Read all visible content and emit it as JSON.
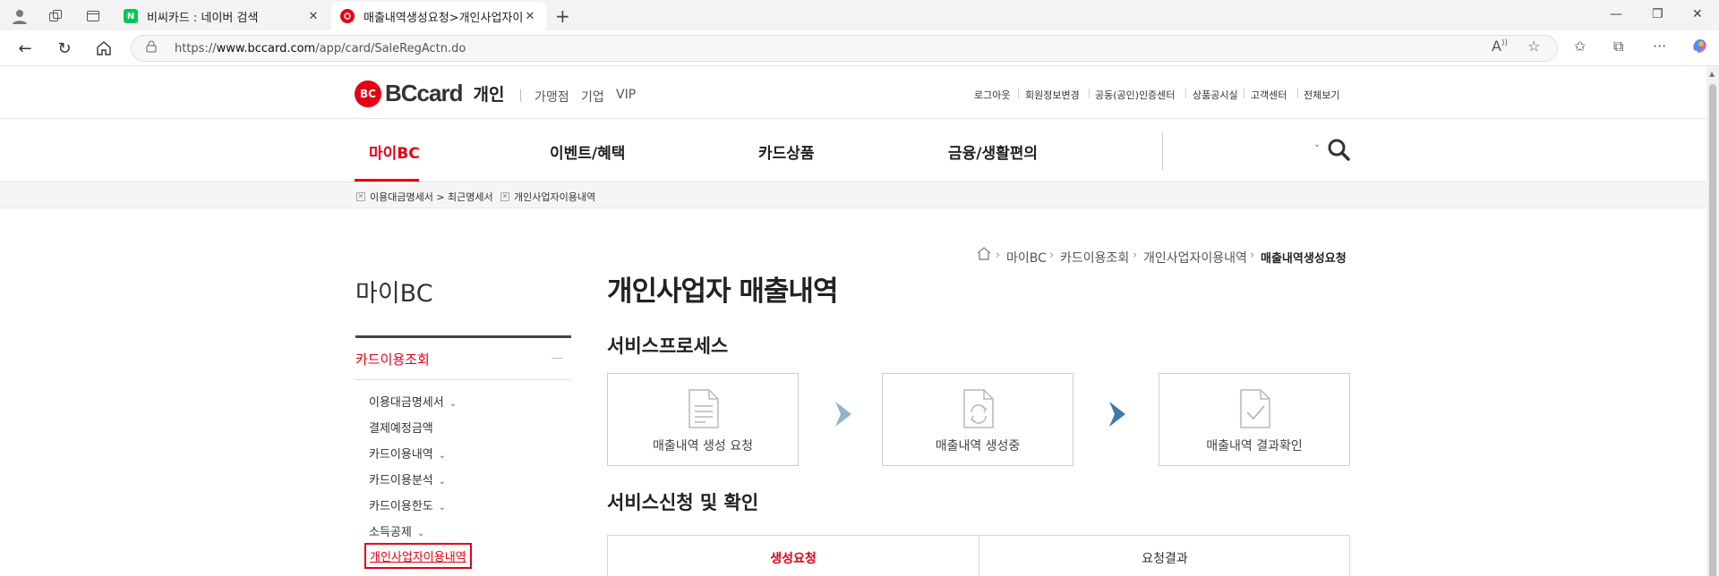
{
  "browser": {
    "tabs": [
      {
        "title": "비씨카드 : 네이버 검색",
        "favicon": "naver-icon",
        "favicon_text": "N",
        "favicon_color": "#03c75a"
      },
      {
        "title": "매출내역생성요청>개인사업자이용내역",
        "favicon": "bccard-icon",
        "favicon_color": "#e60012"
      }
    ],
    "url": {
      "prefix": "https://",
      "host": "www.bccard.com",
      "path": "/app/card/SaleRegActn.do"
    }
  },
  "header": {
    "logo_text": "BCcard",
    "logo_mark": "BC",
    "segment": "개인",
    "subsites": [
      "가맹점",
      "기업",
      "VIP"
    ],
    "util_links": [
      "로그아웃",
      "회원정보변경",
      "공동(공인)인증센터",
      "상품공시실",
      "고객센터",
      "전체보기"
    ]
  },
  "gnb": {
    "menus": [
      "마이BC",
      "이벤트/혜택",
      "카드상품",
      "금융/생활편의"
    ],
    "active_index": 0
  },
  "recent": [
    "이용대금명세서 > 최근명세서",
    "개인사업자이용내역"
  ],
  "breadcrumb": [
    "마이BC",
    "카드이용조회",
    "개인사업자이용내역",
    "매출내역생성요청"
  ],
  "lnb": {
    "title": "마이BC",
    "section": "카드이용조회",
    "items": [
      {
        "label": "이용대금명세서",
        "chev": "⌄"
      },
      {
        "label": "결제예정금액",
        "chev": ""
      },
      {
        "label": "카드이용내역",
        "chev": "⌄"
      },
      {
        "label": "카드이용분석",
        "chev": "⌄"
      },
      {
        "label": "카드이용한도",
        "chev": "⌄"
      },
      {
        "label": "소득공제",
        "chev": "⌄"
      },
      {
        "label": "개인사업자이용내역",
        "chev": ""
      }
    ],
    "active_index": 6
  },
  "content": {
    "title": "개인사업자 매출내역",
    "process_title": "서비스프로세스",
    "steps": [
      "매출내역 생성 요청",
      "매출내역 생성중",
      "매출내역 결과확인"
    ],
    "apply_title": "서비스신청 및 확인",
    "tabs": [
      "생성요청",
      "요청결과"
    ],
    "active_tab": 0
  },
  "colors": {
    "brand": "#e60012",
    "arrow_light": "#8fb4cf",
    "arrow_dark": "#3d7bab"
  }
}
